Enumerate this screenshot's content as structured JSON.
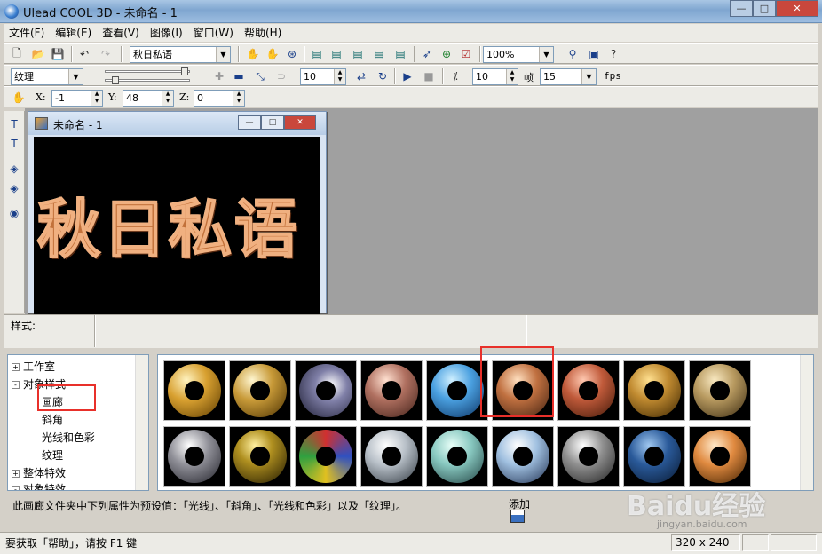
{
  "window": {
    "title": "Ulead COOL 3D - 未命名 - 1"
  },
  "menu": [
    "文件(F)",
    "编辑(E)",
    "查看(V)",
    "图像(I)",
    "窗口(W)",
    "帮助(H)"
  ],
  "toolbar1": {
    "text_combo": "秋日私语",
    "zoom_combo": "100%"
  },
  "toolbar2": {
    "style_combo": "纹理",
    "spin1": "10",
    "spin2": "10",
    "frame_label": "帧",
    "frame_value": "15",
    "fps_label": "fps"
  },
  "toolbar3": {
    "x_label": "X:",
    "x_value": "-1",
    "y_label": "Y:",
    "y_value": "48",
    "z_label": "Z:",
    "z_value": "0"
  },
  "document": {
    "title": "未命名 - 1",
    "canvas_text": "秋日私语"
  },
  "style_panel": {
    "label": "样式:"
  },
  "tree": {
    "items": [
      {
        "label": "工作室",
        "expander": "+"
      },
      {
        "label": "对象样式",
        "expander": "-"
      },
      {
        "label": "画廊",
        "expander": ""
      },
      {
        "label": "斜角",
        "expander": ""
      },
      {
        "label": "光线和色彩",
        "expander": ""
      },
      {
        "label": "纹理",
        "expander": ""
      },
      {
        "label": "整体特效",
        "expander": "+"
      },
      {
        "label": "对象特效",
        "expander": "-"
      }
    ]
  },
  "description": "此画廊文件夹中下列属性为预设值：「光线」、「斜角」、「光线和色彩」以及「纹理」。",
  "add_label": "添加",
  "status": {
    "text": "要获取「帮助」，请按 F1 键",
    "size": "320 x 240"
  },
  "watermark": {
    "text": "Baidu经验",
    "sub": "jingyan.baidu.com"
  },
  "colors": {
    "highlight": "#e8302a",
    "titlebar": "#8fb3da",
    "close": "#c9473c"
  }
}
